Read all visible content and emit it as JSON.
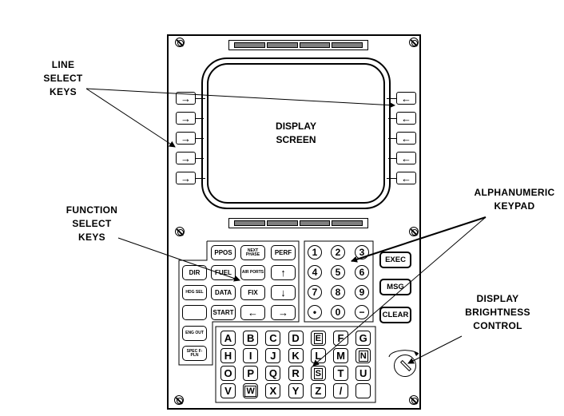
{
  "callouts": {
    "line_select": [
      "LINE",
      "SELECT",
      "KEYS"
    ],
    "function_select": [
      "FUNCTION",
      "SELECT",
      "KEYS"
    ],
    "alphanumeric": [
      "ALPHANUMERIC",
      "KEYPAD"
    ],
    "brightness": [
      "DISPLAY",
      "BRIGHTNESS",
      "CONTROL"
    ]
  },
  "display_screen": [
    "DISPLAY",
    "SCREEN"
  ],
  "line_select_keys": {
    "left": [
      "→",
      "→",
      "→",
      "→",
      "→"
    ],
    "right": [
      "←",
      "←",
      "←",
      "←",
      "←"
    ]
  },
  "function_keys": {
    "row1": [
      "PPOS",
      "NEXT PHASE",
      "PERF"
    ],
    "left_col": [
      "DIR",
      "HDG SEL",
      "",
      "ENG OUT",
      "SPEC F-PLN"
    ],
    "row2": [
      "FUEL",
      "AIR PORTS",
      "↑"
    ],
    "row3": [
      "DATA",
      "FIX",
      "↓"
    ],
    "row4": [
      "START",
      "←",
      "→"
    ]
  },
  "numeric_keys": [
    "1",
    "2",
    "3",
    "4",
    "5",
    "6",
    "7",
    "8",
    "9",
    "•",
    "0",
    "−"
  ],
  "side_keys": [
    "EXEC",
    "MSG",
    "CLEAR"
  ],
  "alpha_keys": [
    [
      "A",
      "B",
      "C",
      "D",
      "E",
      "F",
      "G"
    ],
    [
      "H",
      "I",
      "J",
      "K",
      "L",
      "M",
      "N"
    ],
    [
      "O",
      "P",
      "Q",
      "R",
      "S",
      "T",
      "U"
    ],
    [
      "V",
      "W",
      "X",
      "Y",
      "Z",
      "/",
      ""
    ]
  ],
  "boxed_letters": [
    "E",
    "N",
    "S",
    "W"
  ],
  "colors": {
    "ink": "#000000",
    "lamp": "#808080",
    "background": "#ffffff"
  }
}
